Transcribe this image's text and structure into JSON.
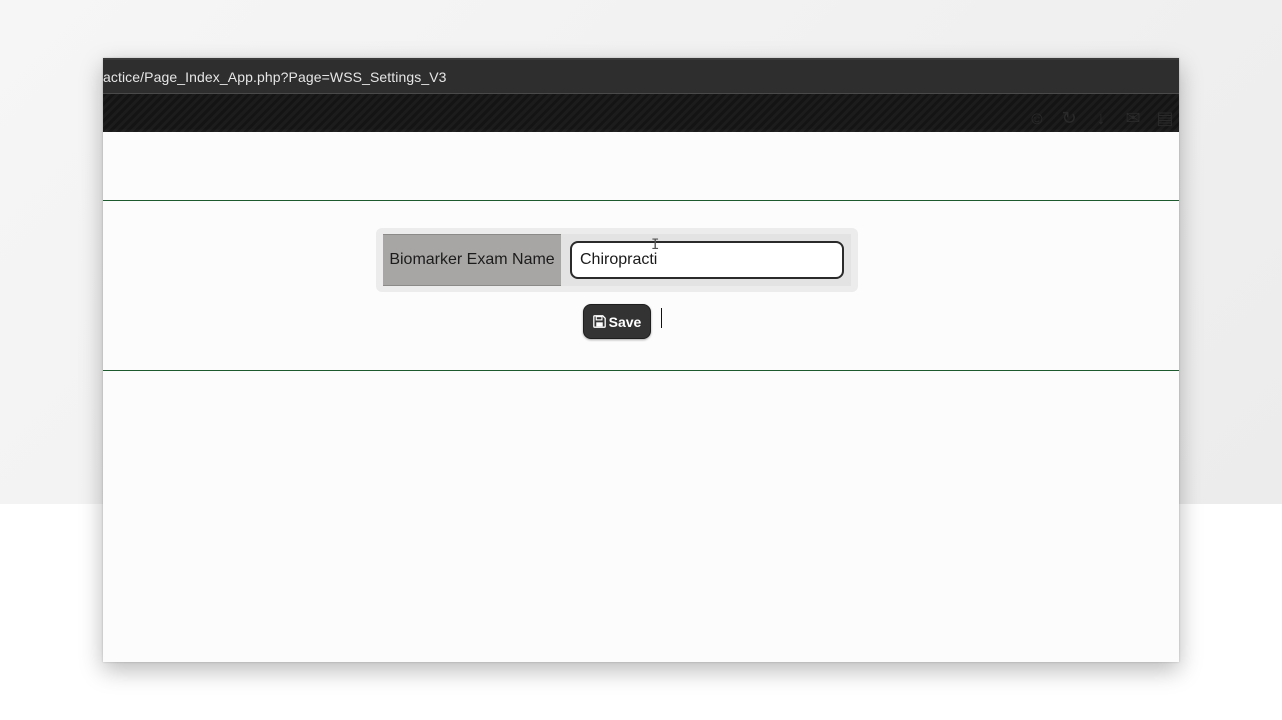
{
  "browser": {
    "url": "actice/Page_Index_App.php?Page=WSS_Settings_V3"
  },
  "form": {
    "label": "Biomarker Exam Name",
    "input_value": "Chiropracti"
  },
  "actions": {
    "save_label": "Save",
    "save_icon": "floppy-disk-icon"
  },
  "colors": {
    "divider": "#1d5a2e",
    "label_bg": "#a8a6a4",
    "button_bg": "#333333"
  }
}
